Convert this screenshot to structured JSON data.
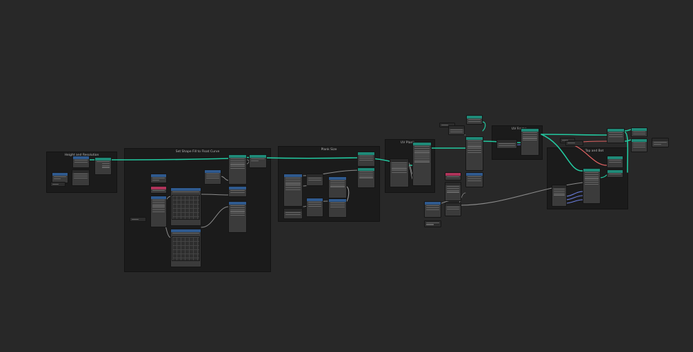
{
  "frames": {
    "height_resolution": "Height and Resolution",
    "shape_fill_curve": "Set Shape Fill to Float Curve",
    "plank_size": "Plank Size",
    "uv_plank": "UV Plank",
    "uv_frame": "UV Frame",
    "top_and_bot": "Top and Bot"
  },
  "colors": {
    "background": "#282828",
    "frame": "#1b1b1b",
    "node_body": "#3b3b3b",
    "geometry_link": "#22c9a0",
    "value_link": "#8c8c8c",
    "shader_link": "#e06262",
    "vector_link": "#6b7fe0"
  }
}
